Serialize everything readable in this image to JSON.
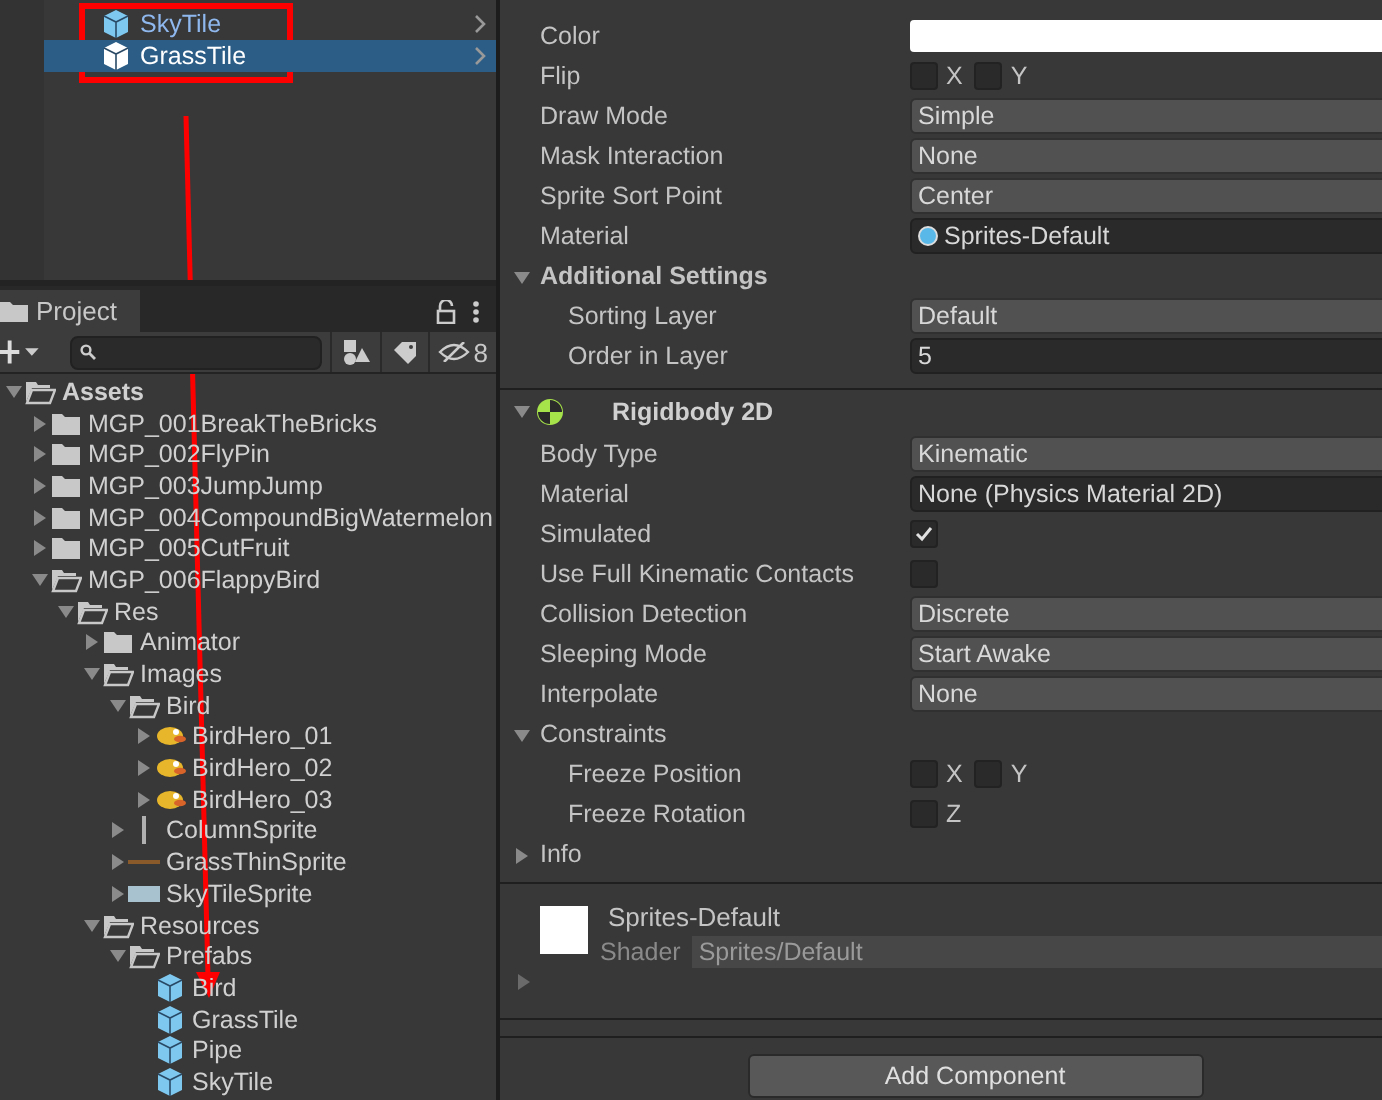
{
  "hierarchy": {
    "items": [
      {
        "name": "SkyTile",
        "selected": false
      },
      {
        "name": "GrassTile",
        "selected": true
      }
    ]
  },
  "project": {
    "tab": "Project",
    "hidden_count": "8",
    "tree": [
      {
        "name": "Assets",
        "kind": "folder",
        "expanded": true,
        "children": [
          {
            "name": "MGP_001BreakTheBricks",
            "kind": "folder",
            "expanded": false
          },
          {
            "name": "MGP_002FlyPin",
            "kind": "folder",
            "expanded": false
          },
          {
            "name": "MGP_003JumpJump",
            "kind": "folder",
            "expanded": false
          },
          {
            "name": "MGP_004CompoundBigWatermelon",
            "kind": "folder",
            "expanded": false
          },
          {
            "name": "MGP_005CutFruit",
            "kind": "folder",
            "expanded": false
          },
          {
            "name": "MGP_006FlappyBird",
            "kind": "folder",
            "expanded": true,
            "children": [
              {
                "name": "Res",
                "kind": "folder",
                "expanded": true,
                "children": [
                  {
                    "name": "Animator",
                    "kind": "folder",
                    "expanded": false
                  },
                  {
                    "name": "Images",
                    "kind": "folder",
                    "expanded": true,
                    "children": [
                      {
                        "name": "Bird",
                        "kind": "folder",
                        "expanded": true,
                        "children": [
                          {
                            "name": "BirdHero_01",
                            "kind": "bird",
                            "expanded": false
                          },
                          {
                            "name": "BirdHero_02",
                            "kind": "bird",
                            "expanded": false
                          },
                          {
                            "name": "BirdHero_03",
                            "kind": "bird",
                            "expanded": false
                          }
                        ]
                      },
                      {
                        "name": "ColumnSprite",
                        "kind": "column",
                        "expanded": false
                      },
                      {
                        "name": "GrassThinSprite",
                        "kind": "strip",
                        "expanded": false
                      },
                      {
                        "name": "SkyTileSprite",
                        "kind": "tile",
                        "expanded": false
                      }
                    ]
                  },
                  {
                    "name": "Resources",
                    "kind": "folder",
                    "expanded": true,
                    "children": [
                      {
                        "name": "Prefabs",
                        "kind": "folder",
                        "expanded": true,
                        "children": [
                          {
                            "name": "Bird",
                            "kind": "prefab"
                          },
                          {
                            "name": "GrassTile",
                            "kind": "prefab"
                          },
                          {
                            "name": "Pipe",
                            "kind": "prefab"
                          },
                          {
                            "name": "SkyTile",
                            "kind": "prefab"
                          }
                        ]
                      }
                    ]
                  }
                ]
              }
            ]
          }
        ]
      }
    ]
  },
  "inspector": {
    "components": [
      {
        "rows": [
          {
            "kind": "color",
            "label": "Color"
          },
          {
            "kind": "toggles",
            "label": "Flip",
            "toggles": [
              {
                "label": "X",
                "checked": false
              },
              {
                "label": "Y",
                "checked": false
              }
            ]
          },
          {
            "kind": "dropdown",
            "label": "Draw Mode",
            "value": "Simple"
          },
          {
            "kind": "dropdown",
            "label": "Mask Interaction",
            "value": "None"
          },
          {
            "kind": "dropdown",
            "label": "Sprite Sort Point",
            "value": "Center"
          },
          {
            "kind": "asset",
            "label": "Material",
            "value": "Sprites-Default"
          },
          {
            "kind": "section",
            "label": "Additional Settings",
            "expanded": true,
            "children": [
              {
                "kind": "dropdown",
                "label": "Sorting Layer",
                "value": "Default"
              },
              {
                "kind": "number",
                "label": "Order in Layer",
                "value": "5"
              }
            ]
          }
        ]
      },
      {
        "title": "Rigidbody 2D",
        "expanded": true,
        "rows": [
          {
            "kind": "dropdown",
            "label": "Body Type",
            "value": "Kinematic"
          },
          {
            "kind": "object",
            "label": "Material",
            "value": "None (Physics Material 2D)"
          },
          {
            "kind": "checkbox",
            "label": "Simulated",
            "checked": true
          },
          {
            "kind": "checkbox",
            "label": "Use Full Kinematic Contacts",
            "checked": false
          },
          {
            "kind": "dropdown",
            "label": "Collision Detection",
            "value": "Discrete"
          },
          {
            "kind": "dropdown",
            "label": "Sleeping Mode",
            "value": "Start Awake"
          },
          {
            "kind": "dropdown",
            "label": "Interpolate",
            "value": "None"
          },
          {
            "kind": "foldout",
            "label": "Constraints",
            "expanded": true,
            "children": [
              {
                "kind": "toggles",
                "label": "Freeze Position",
                "toggles": [
                  {
                    "label": "X",
                    "checked": false
                  },
                  {
                    "label": "Y",
                    "checked": false
                  }
                ]
              },
              {
                "kind": "toggles",
                "label": "Freeze Rotation",
                "toggles": [
                  {
                    "label": "Z",
                    "checked": false
                  }
                ]
              }
            ]
          },
          {
            "kind": "foldout",
            "label": "Info",
            "expanded": false
          }
        ]
      }
    ],
    "material_preview": {
      "name": "Sprites-Default",
      "shader_label": "Shader",
      "shader": "Sprites/Default"
    },
    "add_component": "Add Component"
  }
}
